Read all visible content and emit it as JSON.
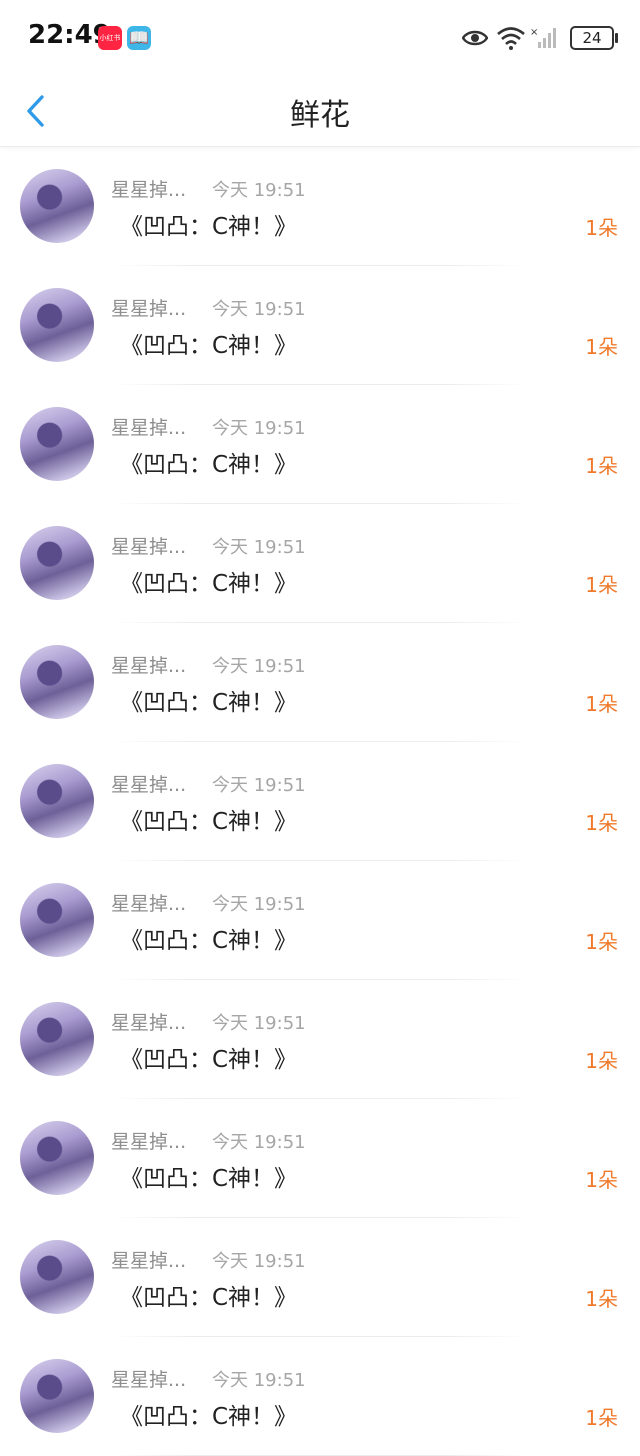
{
  "status_bar": {
    "time": "22:49",
    "app_badge_1": "小红书",
    "app_badge_2": "📖",
    "battery": "24"
  },
  "header": {
    "title": "鲜花"
  },
  "colors": {
    "accent": "#2f9ae8",
    "count": "#f07a2c"
  },
  "items": [
    {
      "user": "星星掉...",
      "time": "今天 19:51",
      "book": "《凹凸：C神！》",
      "count": "1朵"
    },
    {
      "user": "星星掉...",
      "time": "今天 19:51",
      "book": "《凹凸：C神！》",
      "count": "1朵"
    },
    {
      "user": "星星掉...",
      "time": "今天 19:51",
      "book": "《凹凸：C神！》",
      "count": "1朵"
    },
    {
      "user": "星星掉...",
      "time": "今天 19:51",
      "book": "《凹凸：C神！》",
      "count": "1朵"
    },
    {
      "user": "星星掉...",
      "time": "今天 19:51",
      "book": "《凹凸：C神！》",
      "count": "1朵"
    },
    {
      "user": "星星掉...",
      "time": "今天 19:51",
      "book": "《凹凸：C神！》",
      "count": "1朵"
    },
    {
      "user": "星星掉...",
      "time": "今天 19:51",
      "book": "《凹凸：C神！》",
      "count": "1朵"
    },
    {
      "user": "星星掉...",
      "time": "今天 19:51",
      "book": "《凹凸：C神！》",
      "count": "1朵"
    },
    {
      "user": "星星掉...",
      "time": "今天 19:51",
      "book": "《凹凸：C神！》",
      "count": "1朵"
    },
    {
      "user": "星星掉...",
      "time": "今天 19:51",
      "book": "《凹凸：C神！》",
      "count": "1朵"
    },
    {
      "user": "星星掉...",
      "time": "今天 19:51",
      "book": "《凹凸：C神！》",
      "count": "1朵"
    }
  ]
}
